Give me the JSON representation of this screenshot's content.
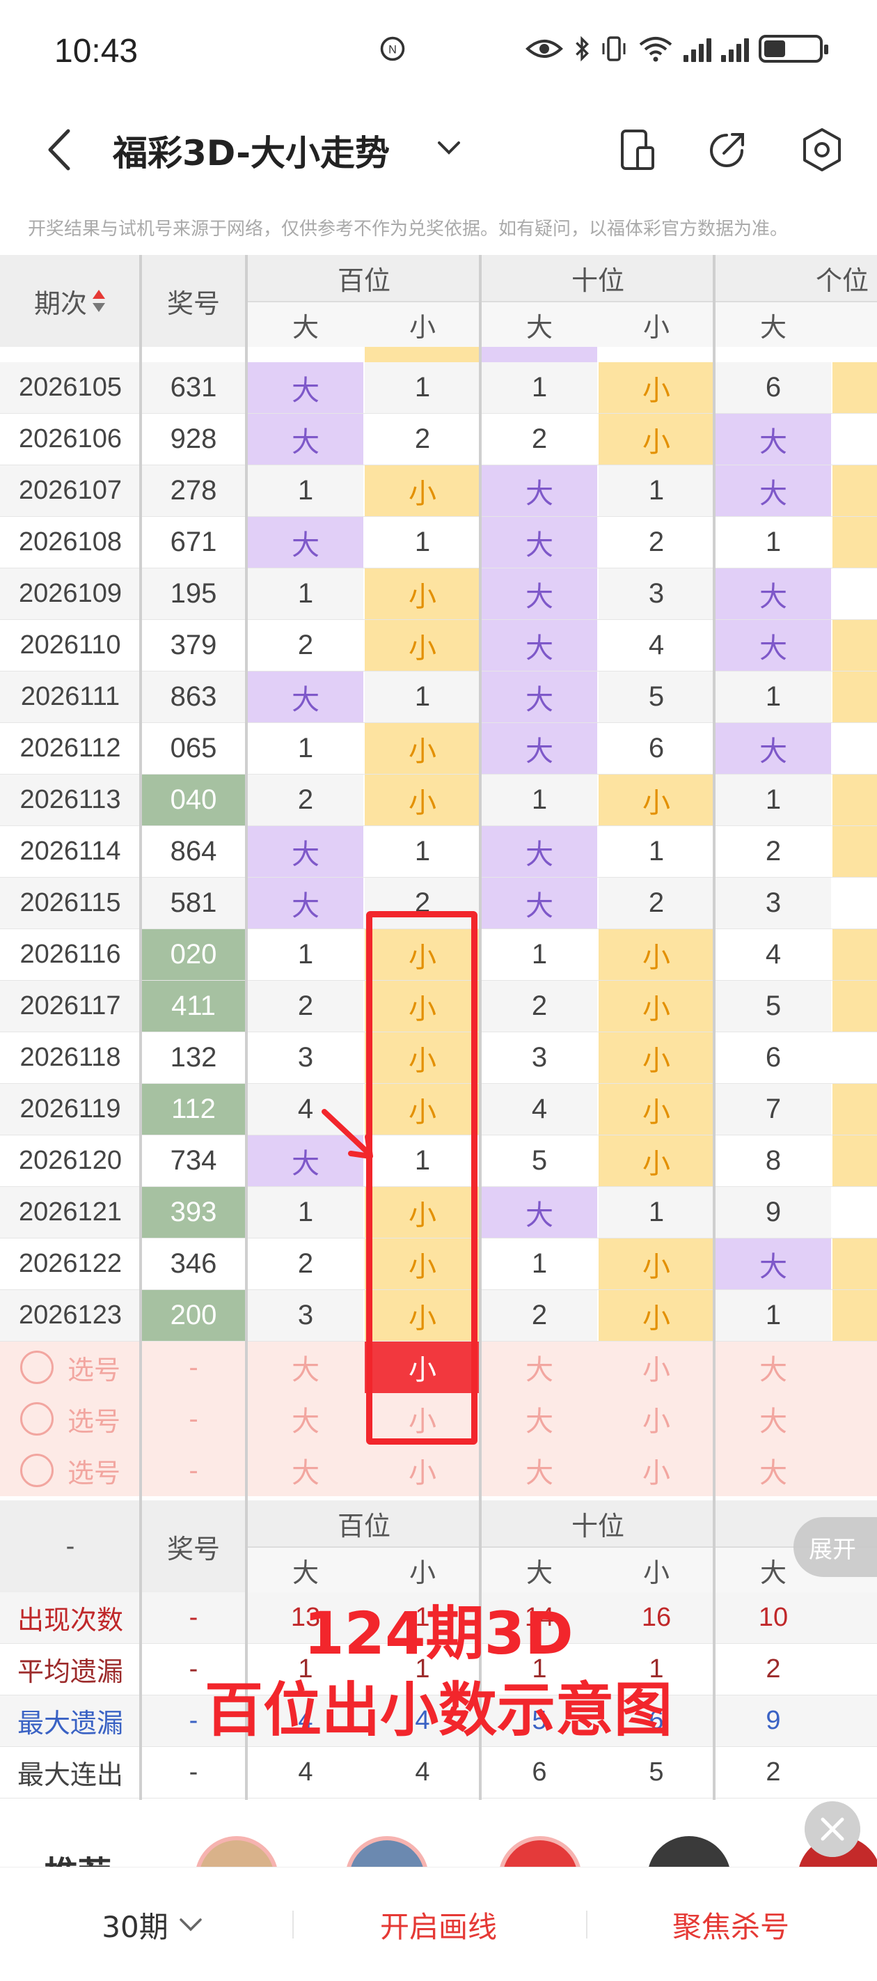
{
  "status": {
    "time": "10:43"
  },
  "nav": {
    "title": "福彩3D-大小走势"
  },
  "notice": "开奖结果与试机号来源于网络，仅供参考不作为兑奖依据。如有疑问，以福体彩官方数据为准。",
  "header": {
    "period": "期次",
    "number": "奖号",
    "groups": [
      "百位",
      "十位",
      "个位"
    ],
    "sub": [
      "大",
      "小",
      "大",
      "小",
      "大"
    ]
  },
  "rows": [
    {
      "period": "2026105",
      "num": "631",
      "green": false,
      "cells": [
        "大",
        "1",
        "1",
        "小",
        "6"
      ]
    },
    {
      "period": "2026106",
      "num": "928",
      "green": false,
      "cells": [
        "大",
        "2",
        "2",
        "小",
        "大"
      ]
    },
    {
      "period": "2026107",
      "num": "278",
      "green": false,
      "cells": [
        "1",
        "小",
        "大",
        "1",
        "大"
      ]
    },
    {
      "period": "2026108",
      "num": "671",
      "green": false,
      "cells": [
        "大",
        "1",
        "大",
        "2",
        "1"
      ]
    },
    {
      "period": "2026109",
      "num": "195",
      "green": false,
      "cells": [
        "1",
        "小",
        "大",
        "3",
        "大"
      ]
    },
    {
      "period": "2026110",
      "num": "379",
      "green": false,
      "cells": [
        "2",
        "小",
        "大",
        "4",
        "大"
      ]
    },
    {
      "period": "2026111",
      "num": "863",
      "green": false,
      "cells": [
        "大",
        "1",
        "大",
        "5",
        "1"
      ]
    },
    {
      "period": "2026112",
      "num": "065",
      "green": false,
      "cells": [
        "1",
        "小",
        "大",
        "6",
        "大"
      ]
    },
    {
      "period": "2026113",
      "num": "040",
      "green": true,
      "cells": [
        "2",
        "小",
        "1",
        "小",
        "1"
      ]
    },
    {
      "period": "2026114",
      "num": "864",
      "green": false,
      "cells": [
        "大",
        "1",
        "大",
        "1",
        "2"
      ]
    },
    {
      "period": "2026115",
      "num": "581",
      "green": false,
      "cells": [
        "大",
        "2",
        "大",
        "2",
        "3"
      ]
    },
    {
      "period": "2026116",
      "num": "020",
      "green": true,
      "cells": [
        "1",
        "小",
        "1",
        "小",
        "4"
      ]
    },
    {
      "period": "2026117",
      "num": "411",
      "green": true,
      "cells": [
        "2",
        "小",
        "2",
        "小",
        "5"
      ]
    },
    {
      "period": "2026118",
      "num": "132",
      "green": false,
      "cells": [
        "3",
        "小",
        "3",
        "小",
        "6"
      ]
    },
    {
      "period": "2026119",
      "num": "112",
      "green": true,
      "cells": [
        "4",
        "小",
        "4",
        "小",
        "7"
      ]
    },
    {
      "period": "2026120",
      "num": "734",
      "green": false,
      "cells": [
        "大",
        "1",
        "5",
        "小",
        "8"
      ]
    },
    {
      "period": "2026121",
      "num": "393",
      "green": true,
      "cells": [
        "1",
        "小",
        "大",
        "1",
        "9"
      ]
    },
    {
      "period": "2026122",
      "num": "346",
      "green": false,
      "cells": [
        "2",
        "小",
        "1",
        "小",
        "大"
      ]
    },
    {
      "period": "2026123",
      "num": "200",
      "green": true,
      "cells": [
        "3",
        "小",
        "2",
        "小",
        "1"
      ]
    }
  ],
  "pick_rows": [
    {
      "label": "选号",
      "num": "-",
      "cells": [
        "大",
        "小",
        "大",
        "小",
        "大"
      ]
    },
    {
      "label": "选号",
      "num": "-",
      "cells": [
        "大",
        "小",
        "大",
        "小",
        "大"
      ]
    },
    {
      "label": "选号",
      "num": "-",
      "cells": [
        "大",
        "小",
        "大",
        "小",
        "大"
      ]
    }
  ],
  "stats_header": {
    "dash": "-",
    "number": "奖号",
    "groups": [
      "百位",
      "十位"
    ],
    "sub": [
      "大",
      "小",
      "大",
      "小",
      "大"
    ],
    "expand": "展开"
  },
  "stats": [
    {
      "label": "出现次数",
      "dash": "-",
      "values": [
        "13",
        "1",
        "14",
        "16",
        "10"
      ],
      "color": "#c0282a"
    },
    {
      "label": "平均遗漏",
      "dash": "-",
      "values": [
        "1",
        "1",
        "1",
        "1",
        "2"
      ],
      "color": "#9c2b2b"
    },
    {
      "label": "最大遗漏",
      "dash": "-",
      "values": [
        "4",
        "4",
        "5",
        "6",
        "9"
      ],
      "color": "#3a62c4"
    },
    {
      "label": "最大连出",
      "dash": "-",
      "values": [
        "4",
        "4",
        "6",
        "5",
        "2"
      ],
      "color": "#444444"
    }
  ],
  "overlay": {
    "line1": "124期3D",
    "line2": "百位出小数示意图"
  },
  "recommend": {
    "title": "推荐"
  },
  "bottom": {
    "periods": "30期",
    "draw_line": "开启画线",
    "focus": "聚焦杀号"
  },
  "colors": {
    "big_bg": "#e1cff7",
    "small_bg": "#fde3a0",
    "green_bg": "#a6c1a1",
    "accent_red": "#f2262c"
  }
}
